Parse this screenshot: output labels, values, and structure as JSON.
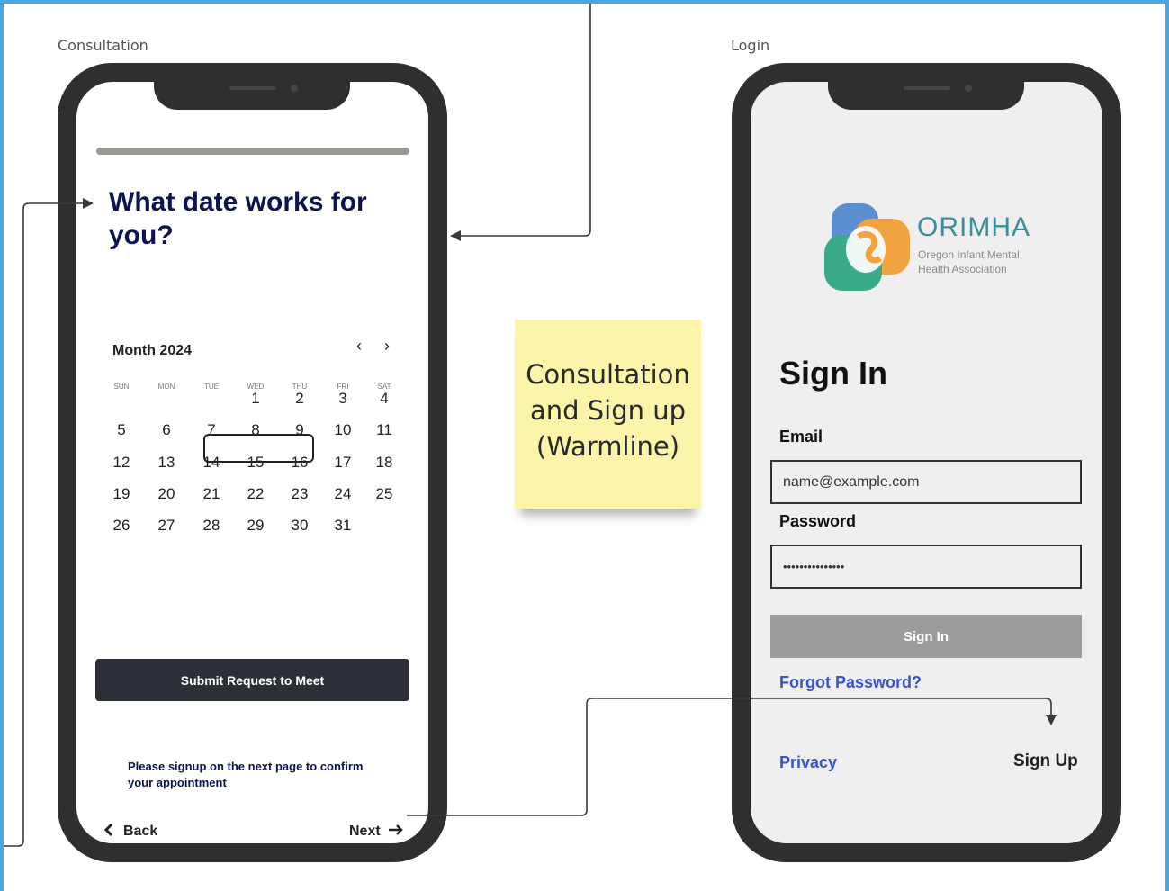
{
  "frames": {
    "consultation_label": "Consultation",
    "login_label": "Login"
  },
  "consultation": {
    "title": "What date works for you?",
    "progress": 1.0,
    "calendar": {
      "month_label": "Month 2024",
      "prev_icon": "‹",
      "next_icon": "›",
      "weekdays": [
        "SUN",
        "MON",
        "TUE",
        "WED",
        "THU",
        "FRI",
        "SAT"
      ],
      "weeks": [
        [
          "",
          "",
          "",
          "1",
          "2",
          "3",
          "4"
        ],
        [
          "5",
          "6",
          "7",
          "8",
          "9",
          "10",
          "11"
        ],
        [
          "12",
          "13",
          "14",
          "15",
          "16",
          "17",
          "18"
        ],
        [
          "19",
          "20",
          "21",
          "22",
          "23",
          "24",
          "25"
        ],
        [
          "26",
          "27",
          "28",
          "29",
          "30",
          "31",
          ""
        ]
      ],
      "selected_range": [
        "7",
        "9"
      ]
    },
    "submit_label": "Submit Request to Meet",
    "note": "Please signup on the next page to confirm your appointment",
    "back_label": "Back",
    "next_label": "Next",
    "back_icon": "chevron-left-icon",
    "next_icon": "arrow-right-icon"
  },
  "sticky_note": {
    "lines": [
      "Consultation",
      "and Sign up",
      "(Warmline)"
    ],
    "color": "#fcf5a9"
  },
  "login": {
    "logo": {
      "word": "ORIMHA",
      "subtitle_line1": "Oregon Infant Mental",
      "subtitle_line2": "Health Association"
    },
    "title": "Sign In",
    "email_label": "Email",
    "email_value": "name@example.com",
    "password_label": "Password",
    "password_value": "•••••••••••••••",
    "signin_label": "Sign In",
    "forgot_label": "Forgot Password?",
    "privacy_label": "Privacy",
    "signup_label": "Sign Up"
  },
  "colors": {
    "frame_border": "#4aa8e0",
    "title_navy": "#0d1452",
    "link_blue": "#3b52c9",
    "phone_body": "#2f2f2f",
    "signin_button": "#9c9c9c"
  }
}
